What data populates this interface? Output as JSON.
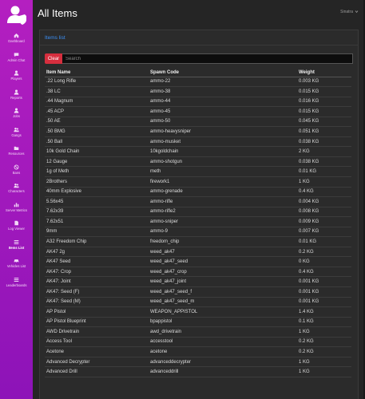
{
  "sidebar": {
    "items": [
      {
        "label": "Dashboard",
        "icon": "home-icon",
        "active": false
      },
      {
        "label": "Admin Chat",
        "icon": "chat-icon",
        "active": false
      },
      {
        "label": "Players",
        "icon": "user-icon",
        "active": false
      },
      {
        "label": "Reports",
        "icon": "user-icon",
        "active": false
      },
      {
        "label": "Jobs",
        "icon": "user-icon",
        "active": false
      },
      {
        "label": "Gangs",
        "icon": "users-icon",
        "active": false
      },
      {
        "label": "Resources",
        "icon": "folder-icon",
        "active": false
      },
      {
        "label": "Bans",
        "icon": "ban-icon",
        "active": false
      },
      {
        "label": "Characters",
        "icon": "users-icon",
        "active": false
      },
      {
        "label": "Server Metrics",
        "icon": "chart-icon",
        "active": false
      },
      {
        "label": "Log Viewer",
        "icon": "document-icon",
        "active": false
      },
      {
        "label": "Items List",
        "icon": "list-icon",
        "active": true
      },
      {
        "label": "Vehicles List",
        "icon": "car-icon",
        "active": false
      },
      {
        "label": "Leaderboards",
        "icon": "list-icon",
        "active": false
      }
    ]
  },
  "header": {
    "title": "All Items",
    "user": "Sinatra"
  },
  "card": {
    "title": "Items list"
  },
  "search": {
    "clear_label": "Clear",
    "placeholder": "Search",
    "value": ""
  },
  "table": {
    "columns": [
      "Item Name",
      "Spawn Code",
      "Weight"
    ],
    "rows": [
      [
        ".22 Long Rifle",
        "ammo-22",
        "0.003 KG"
      ],
      [
        ".38 LC",
        "ammo-38",
        "0.015 KG"
      ],
      [
        ".44 Magnum",
        "ammo-44",
        "0.016 KG"
      ],
      [
        ".45 ACP",
        "ammo-45",
        "0.015 KG"
      ],
      [
        ".50 AE",
        "ammo-50",
        "0.045 KG"
      ],
      [
        ".50 BMG",
        "ammo-heavysniper",
        "0.051 KG"
      ],
      [
        ".50 Ball",
        "ammo-musket",
        "0.038 KG"
      ],
      [
        "10k Gold Chain",
        "10kgoldchain",
        "2 KG"
      ],
      [
        "12 Gauge",
        "ammo-shotgun",
        "0.038 KG"
      ],
      [
        "1g of Meth",
        "meth",
        "0.01 KG"
      ],
      [
        "2Brothers",
        "firework1",
        "1 KG"
      ],
      [
        "40mm Explosive",
        "ammo-grenade",
        "0.4 KG"
      ],
      [
        "5.56x45",
        "ammo-rifle",
        "0.004 KG"
      ],
      [
        "7.62x39",
        "ammo-rifle2",
        "0.008 KG"
      ],
      [
        "7.62x51",
        "ammo-sniper",
        "0.009 KG"
      ],
      [
        "9mm",
        "ammo-9",
        "0.007 KG"
      ],
      [
        "A32 Freedom Chip",
        "freedom_chip",
        "0.01 KG"
      ],
      [
        "AK47 2g",
        "weed_ak47",
        "0.2 KG"
      ],
      [
        "AK47 Seed",
        "weed_ak47_seed",
        "0 KG"
      ],
      [
        "AK47: Crop",
        "weed_ak47_crop",
        "0.4 KG"
      ],
      [
        "AK47: Joint",
        "weed_ak47_joint",
        "0.001 KG"
      ],
      [
        "AK47: Seed (F)",
        "weed_ak47_seed_f",
        "0.001 KG"
      ],
      [
        "AK47: Seed (M)",
        "weed_ak47_seed_m",
        "0.001 KG"
      ],
      [
        "AP Pistol",
        "WEAPON_APPISTOL",
        "1.4 KG"
      ],
      [
        "AP Pistol Blueprint",
        "bpappistol",
        "0.1 KG"
      ],
      [
        "AWD Drivetrain",
        "awd_drivetrain",
        "1 KG"
      ],
      [
        "Access Tool",
        "accesstool",
        "0.2 KG"
      ],
      [
        "Acetone",
        "acetone",
        "0.2 KG"
      ],
      [
        "Advanced Decrypter",
        "advanceddecrypter",
        "1 KG"
      ],
      [
        "Advanced Drill",
        "advanceddrill",
        "1 KG"
      ]
    ]
  },
  "colors": {
    "sidebar_top": "#b41fc0",
    "sidebar_bottom": "#8d13b8",
    "accent": "#3b8ff5",
    "clear": "#d62e3e"
  }
}
